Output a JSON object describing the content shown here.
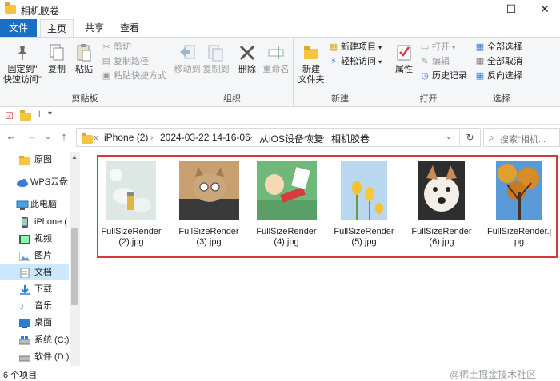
{
  "window": {
    "title": "相机胶卷",
    "minimize": "—",
    "maximize": "☐",
    "close": "✕"
  },
  "ribbon_tabs": [
    {
      "label": "文件"
    },
    {
      "label": "主页"
    },
    {
      "label": "共享"
    },
    {
      "label": "查看"
    }
  ],
  "ribbon": {
    "clipboard": {
      "title": "剪贴板",
      "pin": "固定到\"\n快速访问\"",
      "pin_line1": "固定到\"",
      "pin_line2": "快速访问\"",
      "copy": "复制",
      "paste": "粘贴",
      "cut": "剪切",
      "copy_path": "复制路径",
      "paste_shortcut": "粘贴快捷方式"
    },
    "organize": {
      "title": "组织",
      "move_to": "移动到",
      "copy_to": "复制到",
      "delete": "删除",
      "rename": "重命名"
    },
    "new": {
      "title": "新建",
      "new_folder_line1": "新建",
      "new_folder_line2": "文件夹",
      "new_item": "新建项目",
      "easy_access": "轻松访问"
    },
    "open": {
      "title": "打开",
      "properties": "属性",
      "open": "打开",
      "edit": "编辑",
      "history": "历史记录"
    },
    "select": {
      "title": "选择",
      "select_all": "全部选择",
      "select_none": "全部取消",
      "invert": "反向选择"
    }
  },
  "qat": {
    "dropdown": "▾"
  },
  "address": {
    "crumbs": [
      "iPhone (2)",
      "2024-03-22 14-16-06",
      "从iOS设备恢复",
      "相机胶卷"
    ],
    "overflow": "«",
    "search_placeholder": "搜索\"相机..."
  },
  "sidebar": {
    "items": [
      {
        "label": "原图",
        "icon": "folder-icon"
      },
      {
        "label": "WPS云盘",
        "icon": "cloud-icon"
      },
      {
        "label": "此电脑",
        "icon": "computer-icon"
      },
      {
        "label": "iPhone (",
        "icon": "phone-icon"
      },
      {
        "label": "视频",
        "icon": "video-icon"
      },
      {
        "label": "图片",
        "icon": "picture-icon"
      },
      {
        "label": "文档",
        "icon": "document-icon"
      },
      {
        "label": "下载",
        "icon": "download-icon"
      },
      {
        "label": "音乐",
        "icon": "music-icon"
      },
      {
        "label": "桌面",
        "icon": "desktop-icon"
      },
      {
        "label": "系统 (C:)",
        "icon": "drive-icon"
      },
      {
        "label": "软件 (D:)",
        "icon": "drive-icon"
      }
    ]
  },
  "files": [
    {
      "line1": "FullSizeRender",
      "line2": "(2).jpg"
    },
    {
      "line1": "FullSizeRender",
      "line2": "(3).jpg"
    },
    {
      "line1": "FullSizeRender",
      "line2": "(4).jpg"
    },
    {
      "line1": "FullSizeRender",
      "line2": "(5).jpg"
    },
    {
      "line1": "FullSizeRender",
      "line2": "(6).jpg"
    },
    {
      "line1": "FullSizeRender.j",
      "line2": "pg"
    }
  ],
  "status": {
    "count": "6 个项目"
  },
  "watermark": "@稀土掘金技术社区",
  "colors": {
    "accent": "#1a6fc4",
    "selection": "#cce8ff",
    "highlight_box": "#d9383a"
  }
}
